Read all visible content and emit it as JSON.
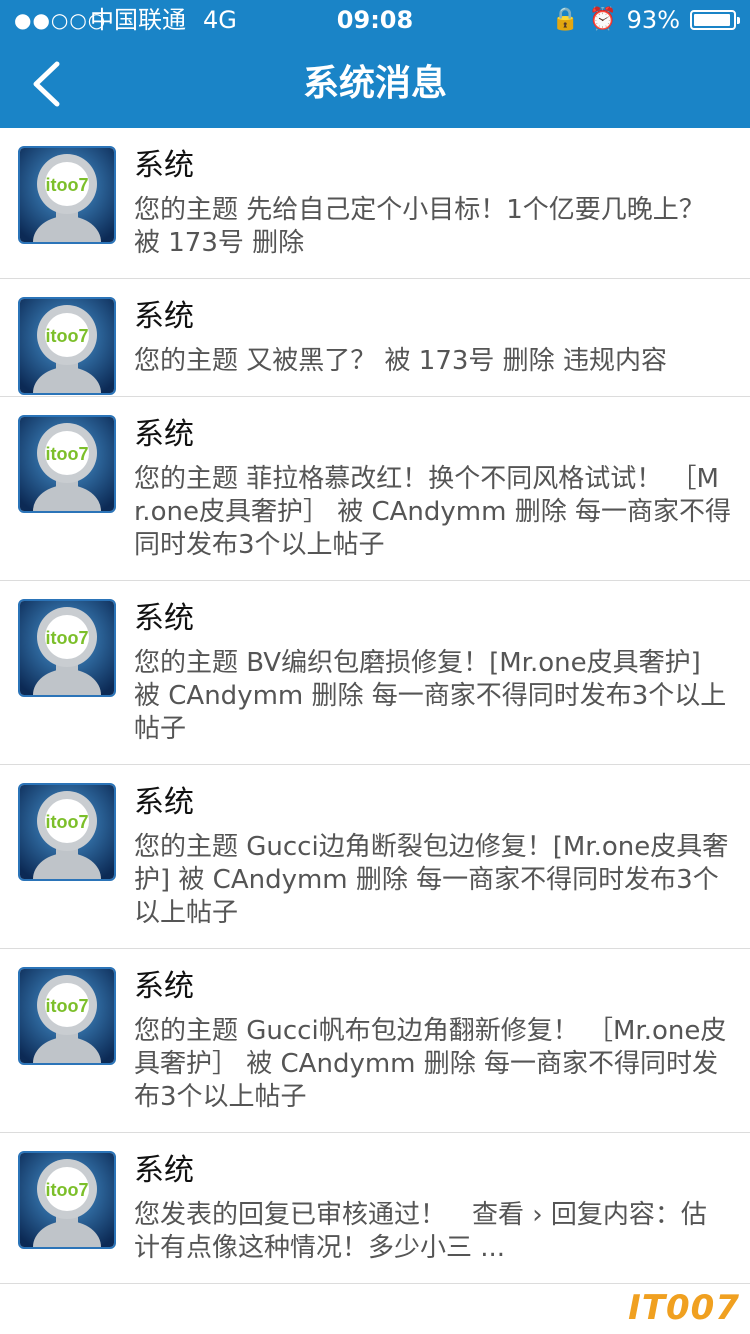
{
  "status": {
    "signal": "●●○○○",
    "carrier": "中国联通",
    "network": "4G",
    "time": "09:08",
    "battery_pct": "93%"
  },
  "nav": {
    "back_icon": "chevron-left-icon",
    "title": "系统消息"
  },
  "messages": [
    {
      "sender": "系统",
      "text": "您的主题 先给自己定个小目标！1个亿要几晚上？ 被 173号 删除"
    },
    {
      "sender": "系统",
      "text": "您的主题 又被黑了？ 被 173号 删除 违规内容"
    },
    {
      "sender": "系统",
      "text": "您的主题 菲拉格慕改红！换个不同风格试试！ ［Mr.one皮具奢护］ 被 CAndymm 删除 每一商家不得同时发布3个以上帖子"
    },
    {
      "sender": "系统",
      "text": "您的主题 BV编织包磨损修复！[Mr.one皮具奢护] 被 CAndymm 删除 每一商家不得同时发布3个以上帖子"
    },
    {
      "sender": "系统",
      "text": "您的主题 Gucci边角断裂包边修复！[Mr.one皮具奢护] 被 CAndymm 删除 每一商家不得同时发布3个以上帖子"
    },
    {
      "sender": "系统",
      "text": "您的主题 Gucci帆布包边角翻新修复！ ［Mr.one皮具奢护］ 被 CAndymm 删除 每一商家不得同时发布3个以上帖子"
    },
    {
      "sender": "系统",
      "text": "您发表的回复已审核通过！　查看 › 回复内容：估计有点像这种情况！多少小三 ..."
    }
  ],
  "avatar_logo_text": "itoo7",
  "watermark": "IT007",
  "colors": {
    "header": "#1a84c7",
    "divider": "#dcdcdc",
    "message_text": "#555555"
  }
}
